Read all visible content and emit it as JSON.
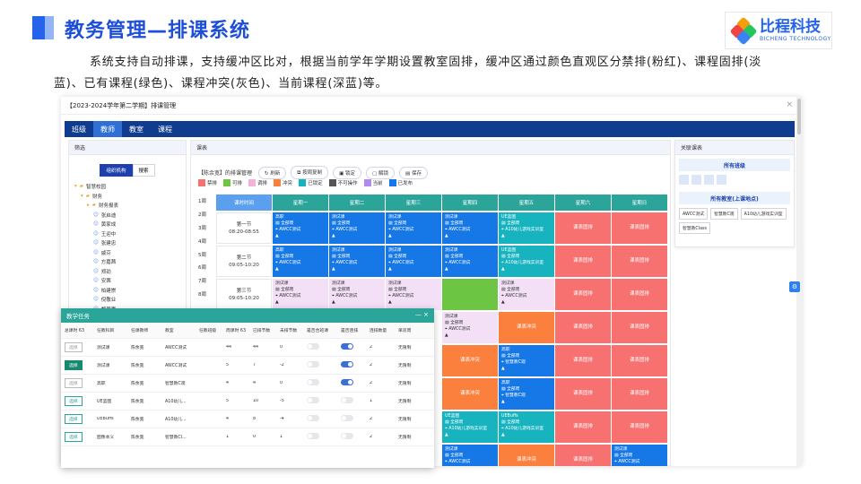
{
  "slide": {
    "title": "教务管理—排课系统",
    "description": "系统支持自动排课，支持缓冲区比对，根据当前学年学期设置教室固排，缓冲区通过颜色直观区分禁排(粉红)、课程固排(淡蓝)、已有课程(绿色)、课程冲突(灰色)、当前课程(深蓝)等。",
    "logo_main": "比程科技",
    "logo_sub": "BICHENG TECHNOLOGY"
  },
  "app": {
    "window_title": "【2023-2024学年第二学期】排课管理",
    "close": "×",
    "nav_tabs": [
      "班级",
      "教师",
      "教室",
      "课程"
    ],
    "active_tab": 1
  },
  "left": {
    "header": "筛选",
    "seg": [
      "组织机构",
      "搜索"
    ],
    "tree": [
      {
        "icon": "folder",
        "label": "智慧校园",
        "indent": 0,
        "arrow": "▾"
      },
      {
        "icon": "folder",
        "label": "财务",
        "indent": 1,
        "arrow": "▾"
      },
      {
        "icon": "folder",
        "label": "财务报表",
        "indent": 2,
        "arrow": "▸"
      },
      {
        "icon": "person",
        "label": "张启迪",
        "indent": 3
      },
      {
        "icon": "person",
        "label": "黄家成",
        "indent": 3
      },
      {
        "icon": "person",
        "label": "王迎中",
        "indent": 3
      },
      {
        "icon": "person",
        "label": "张建忠",
        "indent": 3
      },
      {
        "icon": "person",
        "label": "戚芬",
        "indent": 3
      },
      {
        "icon": "person",
        "label": "方嘉茜",
        "indent": 3
      },
      {
        "icon": "person",
        "label": "郑劲",
        "indent": 3
      },
      {
        "icon": "person",
        "label": "安茜",
        "indent": 3
      },
      {
        "icon": "person",
        "label": "柏建崇",
        "indent": 3
      },
      {
        "icon": "person",
        "label": "倪敬业",
        "indent": 3
      },
      {
        "icon": "person",
        "label": "黎周嘉",
        "indent": 3
      }
    ]
  },
  "schedule": {
    "header": "课表",
    "toolbar_title": "【陈余宽】的排课管理",
    "buttons": [
      "刷新",
      "按周复制",
      "锁定",
      "解锁",
      "保存"
    ],
    "legend": [
      {
        "label": "禁排",
        "color": "#f87171"
      },
      {
        "label": "可排",
        "color": "#6cc644"
      },
      {
        "label": "调排",
        "color": "#f3b3d6"
      },
      {
        "label": "冲突",
        "color": "#fb7f3d"
      },
      {
        "label": "已锁定",
        "color": "#17b3bf"
      },
      {
        "label": "不可操作",
        "color": "#555555"
      },
      {
        "label": "当前",
        "color": "#b28ce8"
      },
      {
        "label": "已发布",
        "color": "#1677e6"
      }
    ],
    "weeks": [
      "1周",
      "2周",
      "3周",
      "4周",
      "5周",
      "6周",
      "7周",
      "8周"
    ],
    "columns": [
      "课时时间",
      "星期一",
      "星期二",
      "星期三",
      "星期四",
      "星期五",
      "星期六",
      "星期日"
    ],
    "rows": [
      {
        "time": [
          "第一节",
          "08:20-08:55"
        ],
        "cells": [
          {
            "c": "blue",
            "t": [
              "高职",
              "全部周",
              "AWCC测试"
            ]
          },
          {
            "c": "blue",
            "t": [
              "测试课",
              "全部周",
              "AWCC测试"
            ]
          },
          {
            "c": "blue",
            "t": [
              "测试课",
              "全部周",
              "AWCC测试"
            ]
          },
          {
            "c": "blue",
            "t": [
              "测试课",
              "全部周",
              "AWCC测试"
            ]
          },
          {
            "c": "teal",
            "t": [
              "UE蓝图",
              "全部周",
              "A10幼儿游戏实训室"
            ]
          },
          {
            "c": "red",
            "center": "课表固排"
          },
          {
            "c": "red",
            "center": "课表固排"
          }
        ]
      },
      {
        "time": [
          "第二节",
          "09:05-10:20"
        ],
        "cells": [
          {
            "c": "blue",
            "t": [
              "高职",
              "全部周",
              "AWCC测试"
            ]
          },
          {
            "c": "blue",
            "t": [
              "测试课",
              "全部周",
              "AWCC测试"
            ]
          },
          {
            "c": "blue",
            "t": [
              "测试课",
              "全部周",
              "AWCC测试"
            ]
          },
          {
            "c": "blue",
            "t": [
              "测试课",
              "全部周",
              "AWCC测试"
            ]
          },
          {
            "c": "teal",
            "t": [
              "UE蓝图",
              "全部周",
              "A10幼儿游戏实训室"
            ]
          },
          {
            "c": "red",
            "center": "课表固排"
          },
          {
            "c": "red",
            "center": "课表固排"
          }
        ]
      },
      {
        "time": [
          "第三节",
          "09:05-10:20"
        ],
        "cells": [
          {
            "c": "pink",
            "t": [
              "测试课",
              "全部周",
              "AWCC测试"
            ]
          },
          {
            "c": "pink",
            "t": [
              "测试课",
              "全部周",
              "AWCC测试"
            ]
          },
          {
            "c": "pink",
            "t": [
              "测试课",
              "全部周",
              "AWCC测试"
            ]
          },
          {
            "c": "green",
            "t": []
          },
          {
            "c": "pink",
            "t": [
              "测试课",
              "全部周",
              "AWCC测试"
            ]
          },
          {
            "c": "red",
            "center": "课表固排"
          },
          {
            "c": "red",
            "center": "课表固排"
          }
        ]
      },
      {
        "time": [
          "",
          ""
        ],
        "cells": [
          {
            "c": "white",
            "t": []
          },
          {
            "c": "white",
            "t": []
          },
          {
            "c": "white",
            "t": []
          },
          {
            "c": "pink",
            "t": [
              "测试课",
              "全部周",
              "AWCC测试"
            ]
          },
          {
            "c": "orange",
            "center": "课表冲突"
          },
          {
            "c": "red",
            "center": "课表固排"
          },
          {
            "c": "red",
            "center": "课表固排"
          }
        ]
      },
      {
        "time": [
          "",
          ""
        ],
        "cells": [
          {
            "c": "white",
            "t": []
          },
          {
            "c": "white",
            "t": []
          },
          {
            "c": "white",
            "t": []
          },
          {
            "c": "orange",
            "center": "课表冲突"
          },
          {
            "c": "blue",
            "t": [
              "高职",
              "全部周",
              "智慧教C观"
            ]
          },
          {
            "c": "red",
            "center": "课表固排"
          },
          {
            "c": "red",
            "center": "课表固排"
          }
        ]
      },
      {
        "time": [
          "",
          ""
        ],
        "cells": [
          {
            "c": "white",
            "t": []
          },
          {
            "c": "white",
            "t": []
          },
          {
            "c": "white",
            "t": []
          },
          {
            "c": "orange",
            "center": "课表冲突"
          },
          {
            "c": "blue",
            "t": [
              "高职",
              "全部周",
              "智慧教C观"
            ]
          },
          {
            "c": "red",
            "center": "课表固排"
          },
          {
            "c": "red",
            "center": "课表固排"
          }
        ]
      },
      {
        "time": [
          "",
          ""
        ],
        "cells": [
          {
            "c": "white",
            "t": []
          },
          {
            "c": "white",
            "t": []
          },
          {
            "c": "white",
            "t": []
          },
          {
            "c": "teal",
            "t": [
              "UE蓝图",
              "全部周",
              "A10幼儿游戏实训室"
            ]
          },
          {
            "c": "teal",
            "t": [
              "UEBuffs",
              "全部周",
              "A10幼儿游戏实训室"
            ]
          },
          {
            "c": "red",
            "center": "课表固排"
          },
          {
            "c": "red",
            "center": "课表固排"
          }
        ]
      },
      {
        "time": [
          "",
          ""
        ],
        "cells": [
          {
            "c": "white",
            "t": []
          },
          {
            "c": "white",
            "t": []
          },
          {
            "c": "white",
            "t": []
          },
          {
            "c": "blue",
            "t": [
              "测试课",
              "全部周",
              "AWCC测试"
            ]
          },
          {
            "c": "orange",
            "center": "课表冲突"
          },
          {
            "c": "red",
            "center": "课表固排"
          },
          {
            "c": "blue",
            "t": [
              "测试课",
              "全部周",
              "AWCC测试"
            ]
          }
        ]
      }
    ]
  },
  "right": {
    "header": "关联课表",
    "sec1": "所有班级",
    "sec2": "所有教室(上课地点)",
    "rooms": [
      "AWCC测试",
      "智慧教C观",
      "A10幼儿游戏实训室",
      "智慧教Class"
    ]
  },
  "dialog": {
    "title": "教学任务",
    "controls": "—  ×",
    "headers": [
      "总课时 63",
      "任教科目",
      "任课教师",
      "教室",
      "任教班级",
      "周课时 63",
      "已排节数",
      "未排节数",
      "是否合班课",
      "是否连排",
      "连排数量",
      "单双周"
    ],
    "rows": [
      {
        "sel": "选择",
        "selState": "off",
        "subject": "测试课",
        "teacher": "陈余宽",
        "room": "AWCC测试",
        "cls": "",
        "week": "44",
        "done": "44",
        "left": "0",
        "merge": false,
        "cont": true,
        "num": "2",
        "ab": "无限制"
      },
      {
        "sel": "选择",
        "selState": "solid",
        "subject": "测试课",
        "teacher": "陈余宽",
        "room": "AWCC测试",
        "cls": "",
        "week": "5",
        "done": "7",
        "left": "-2",
        "merge": false,
        "cont": true,
        "num": "2",
        "ab": "无限制"
      },
      {
        "sel": "选择",
        "selState": "off",
        "subject": "高职",
        "teacher": "陈余宽",
        "room": "智慧教C观",
        "cls": "",
        "week": "4",
        "done": "4",
        "left": "0",
        "merge": false,
        "cont": true,
        "num": "2",
        "ab": "无限制"
      },
      {
        "sel": "选择",
        "selState": "on",
        "subject": "UE蓝图",
        "teacher": "陈余宽",
        "room": "A10幼儿...",
        "cls": "",
        "week": "5",
        "done": "10",
        "left": "-5",
        "merge": false,
        "cont": false,
        "num": "1",
        "ab": "无限制"
      },
      {
        "sel": "选择",
        "selState": "on",
        "subject": "UEBuffs",
        "teacher": "陈余宽",
        "room": "A10幼儿...",
        "cls": "",
        "week": "4",
        "done": "8",
        "left": "-4",
        "merge": false,
        "cont": false,
        "num": "2",
        "ab": "无限制"
      },
      {
        "sel": "选择",
        "selState": "on",
        "subject": "图像本义",
        "teacher": "陈余宽",
        "room": "智慧教Cl...",
        "cls": "",
        "week": "1",
        "done": "0",
        "left": "1",
        "merge": false,
        "cont": false,
        "num": "2",
        "ab": "无限制"
      }
    ]
  }
}
